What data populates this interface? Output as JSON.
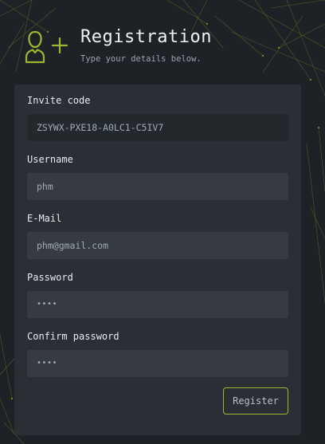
{
  "header": {
    "title": "Registration",
    "subtitle": "Type your details below.",
    "icon": "user-add-icon"
  },
  "form": {
    "fields": [
      {
        "label": "Invite code",
        "value": "ZSYWX-PXE18-A0LC1-C5IV7",
        "readonly": true
      },
      {
        "label": "Username",
        "value": "phm"
      },
      {
        "label": "E-Mail",
        "value": "phm@gmail.com"
      },
      {
        "label": "Password",
        "value": "••••"
      },
      {
        "label": "Confirm password",
        "value": "••••"
      }
    ],
    "submit_label": "Register"
  },
  "colors": {
    "background": "#1e2227",
    "panel": "#2c3136",
    "input": "#353b41",
    "accent": "#9ab832"
  }
}
